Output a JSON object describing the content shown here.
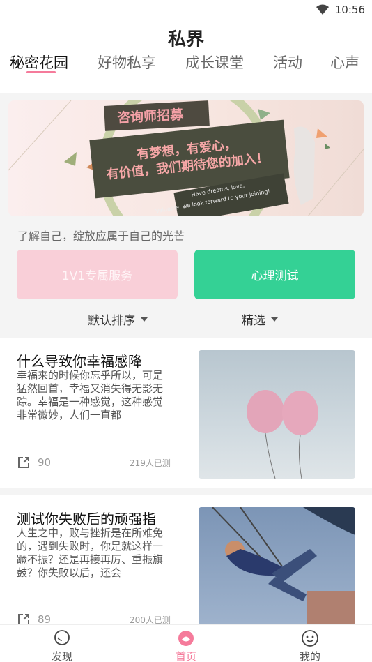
{
  "status": {
    "time": "10:56"
  },
  "header": {
    "title": "私界",
    "tabs": [
      {
        "label": "秘密花园"
      },
      {
        "label": "好物私享"
      },
      {
        "label": "成长课堂"
      },
      {
        "label": "活动"
      },
      {
        "label": "心声"
      }
    ]
  },
  "banner": {
    "headline": "咨询师招募",
    "line1": "有梦想，有爱心，",
    "line2": "有价值，我们期待您的加入！",
    "english1": "Have dreams, love,",
    "english2": "Valuable, we look forward to your joining!",
    "subtitle": "了解自己，绽放应属于自己的光芒"
  },
  "buttons": {
    "service": "1V1专属服务",
    "test": "心理测试"
  },
  "filters": {
    "sort": "默认排序",
    "select": "精选"
  },
  "cards": [
    {
      "title": "什么导致你幸福感降",
      "desc": "幸福来的时候你忘乎所以，可是猛然回首，幸福又消失得无影无踪。幸福是一种感觉，这种感觉非常微妙，人们一直都",
      "shares": "90",
      "count": "219人已测"
    },
    {
      "title": "测试你失败后的顽强指",
      "desc": "人生之中，败与挫折是在所难免的，遇到失败时，你是就这样一蹶不振？还是再接再厉、重振旗鼓？你失败以后，还会",
      "shares": "89",
      "count": "200人已测"
    }
  ],
  "nav": {
    "discover": "发现",
    "home": "首页",
    "mine": "我的"
  },
  "colors": {
    "accent": "#f57b9b",
    "green": "#34d195",
    "pink_button": "#f9cfd8"
  }
}
